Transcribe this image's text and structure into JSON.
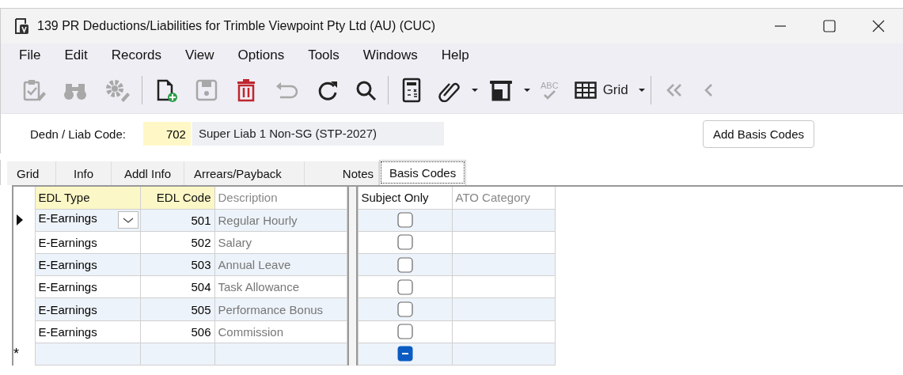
{
  "window": {
    "title": "139 PR Deductions/Liabilities for Trimble Viewpoint Pty Ltd (AU) (CUC)"
  },
  "menu": [
    "File",
    "Edit",
    "Records",
    "View",
    "Options",
    "Tools",
    "Windows",
    "Help"
  ],
  "toolbar": [
    {
      "kind": "clipboard",
      "disabled": true
    },
    {
      "kind": "binoculars",
      "disabled": true
    },
    {
      "kind": "gear",
      "disabled": true
    },
    {
      "kind": "separator"
    },
    {
      "kind": "new",
      "disabled": false
    },
    {
      "kind": "save",
      "disabled": true
    },
    {
      "kind": "delete",
      "disabled": false
    },
    {
      "kind": "undo",
      "disabled": true
    },
    {
      "kind": "refresh",
      "disabled": false
    },
    {
      "kind": "search",
      "disabled": false
    },
    {
      "kind": "separator"
    },
    {
      "kind": "calculator",
      "disabled": false
    },
    {
      "kind": "paperclip",
      "disabled": false
    },
    {
      "kind": "caret",
      "disabled": false
    },
    {
      "kind": "tray",
      "disabled": false
    },
    {
      "kind": "caret",
      "disabled": false
    },
    {
      "kind": "spell",
      "disabled": true,
      "label": "ABC"
    },
    {
      "kind": "grid",
      "disabled": false,
      "label": "Grid"
    },
    {
      "kind": "caret",
      "disabled": false
    },
    {
      "kind": "separator"
    },
    {
      "kind": "first",
      "disabled": true
    },
    {
      "kind": "prev",
      "disabled": true
    }
  ],
  "form": {
    "code_label": "Dedn / Liab Code:",
    "code": "702",
    "description": "Super Liab 1 Non-SG (STP-2027)",
    "button": "Add Basis Codes"
  },
  "tabs": [
    {
      "label": "Grid",
      "selected": false
    },
    {
      "label": "Info",
      "selected": false
    },
    {
      "label": "Addl Info",
      "selected": false
    },
    {
      "label": "Arrears/Payback",
      "selected": false
    },
    {
      "label": "Notes",
      "selected": false
    },
    {
      "label": "Basis Codes",
      "selected": true
    }
  ],
  "grid": {
    "columns": [
      {
        "label": "EDL Type",
        "required": true,
        "readonly": false
      },
      {
        "label": "EDL Code",
        "required": true,
        "readonly": false
      },
      {
        "label": "Description",
        "required": false,
        "readonly": true
      },
      {
        "label": "Subject Only",
        "required": false,
        "readonly": false
      },
      {
        "label": "ATO Category",
        "required": false,
        "readonly": true
      }
    ],
    "rows": [
      {
        "current": true,
        "editing": true,
        "edl_type": "E-Earnings",
        "edl_code": "501",
        "description": "Regular Hourly",
        "subject_only_indeterminate": false
      },
      {
        "current": false,
        "editing": false,
        "edl_type": "E-Earnings",
        "edl_code": "502",
        "description": "Salary",
        "subject_only_indeterminate": false
      },
      {
        "current": false,
        "editing": false,
        "edl_type": "E-Earnings",
        "edl_code": "503",
        "description": "Annual Leave",
        "subject_only_indeterminate": false
      },
      {
        "current": false,
        "editing": false,
        "edl_type": "E-Earnings",
        "edl_code": "504",
        "description": "Task Allowance",
        "subject_only_indeterminate": false
      },
      {
        "current": false,
        "editing": false,
        "edl_type": "E-Earnings",
        "edl_code": "505",
        "description": "Performance Bonus",
        "subject_only_indeterminate": false
      },
      {
        "current": false,
        "editing": false,
        "edl_type": "E-Earnings",
        "edl_code": "506",
        "description": "Commission",
        "subject_only_indeterminate": false
      },
      {
        "current": false,
        "new_marker": "*",
        "editing": false,
        "subject_only_indeterminate": true
      }
    ]
  }
}
